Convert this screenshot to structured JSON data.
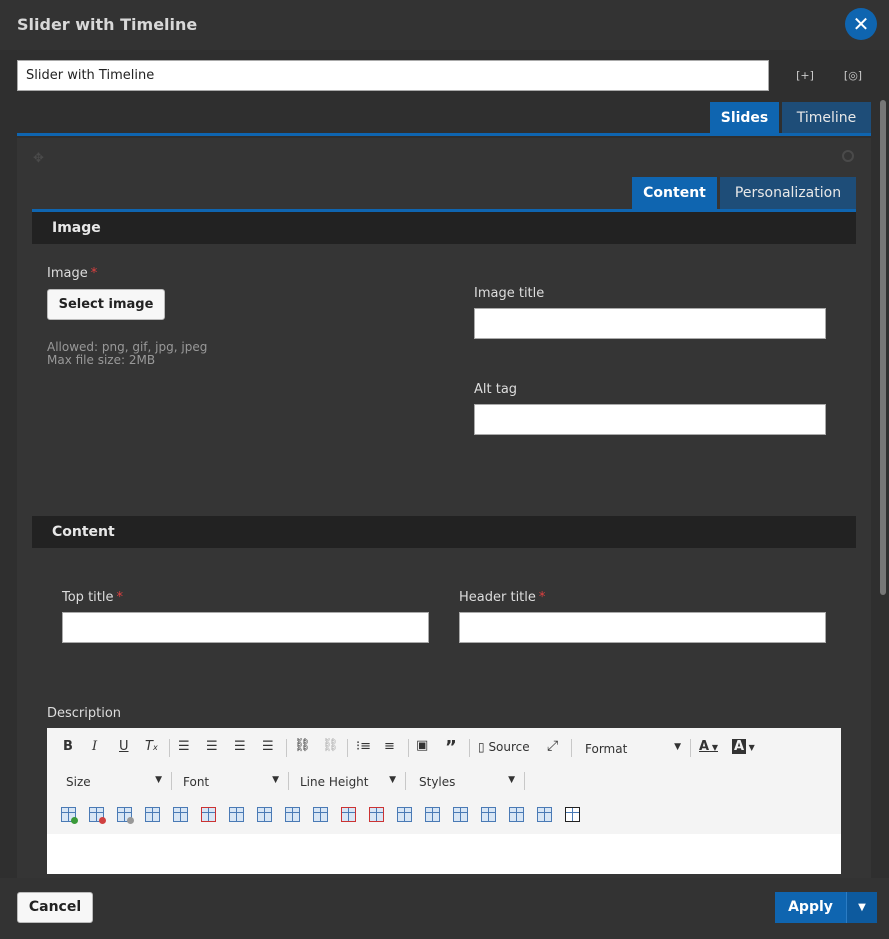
{
  "window": {
    "title": "Slider with Timeline"
  },
  "name_field": {
    "value": "Slider with Timeline"
  },
  "top_icons": {
    "expand": "[+]",
    "preview": "[◎]"
  },
  "top_tabs": [
    {
      "label": "Slides"
    },
    {
      "label": "Timeline"
    }
  ],
  "inner_tabs": [
    {
      "label": "Content"
    },
    {
      "label": "Personalization"
    }
  ],
  "image_section": {
    "title": "Image",
    "image_label": "Image",
    "required_mark": "*",
    "select_button": "Select image",
    "hint_allowed": "Allowed: png, gif, jpg, jpeg",
    "hint_size": "Max file size: 2MB",
    "image_title_label": "Image title",
    "alt_tag_label": "Alt tag"
  },
  "content_section": {
    "title": "Content",
    "top_title_label": "Top title",
    "header_title_label": "Header title",
    "description_label": "Description"
  },
  "editor_toolbar": {
    "source_label": "Source",
    "format_label": "Format",
    "size_label": "Size",
    "font_label": "Font",
    "line_height_label": "Line Height",
    "styles_label": "Styles"
  },
  "footer": {
    "cancel_label": "Cancel",
    "apply_label": "Apply"
  },
  "colors": {
    "accent": "#0f65b0",
    "required": "#e04040"
  }
}
